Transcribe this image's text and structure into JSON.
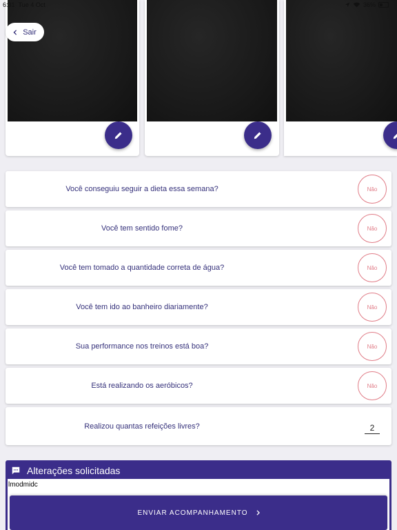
{
  "status": {
    "time": "6:31",
    "date": "Tue 4 Oct",
    "battery": "36%",
    "battery_level": 0.36
  },
  "header": {
    "back_label": "Sair"
  },
  "photos": [
    {
      "edit_icon": "pencil-icon"
    },
    {
      "edit_icon": "pencil-icon"
    },
    {
      "edit_icon": "pencil-icon"
    }
  ],
  "questions": [
    {
      "text": "Você conseguiu seguir a dieta essa semana?",
      "answer": "Não"
    },
    {
      "text": "Você tem sentido fome?",
      "answer": "Não"
    },
    {
      "text": "Você tem tomado a quantidade correta de água?",
      "answer": "Não"
    },
    {
      "text": "Você tem ido ao banheiro diariamente?",
      "answer": "Não"
    },
    {
      "text": "Sua performance nos treinos está boa?",
      "answer": "Não"
    },
    {
      "text": "Está realizando os aeróbicos?",
      "answer": "Não"
    }
  ],
  "meals": {
    "text": "Realizou quantas refeições livres?",
    "value": "2"
  },
  "changes": {
    "title": "Alterações solicitadas",
    "value": "lmodmidc",
    "icon": "comment-icon"
  },
  "submit": {
    "label": "ENVIAR ACOMPANHAMENTO"
  },
  "colors": {
    "primary": "#3b2d8a",
    "no_button": "#e07b86",
    "background": "#efeef3"
  }
}
